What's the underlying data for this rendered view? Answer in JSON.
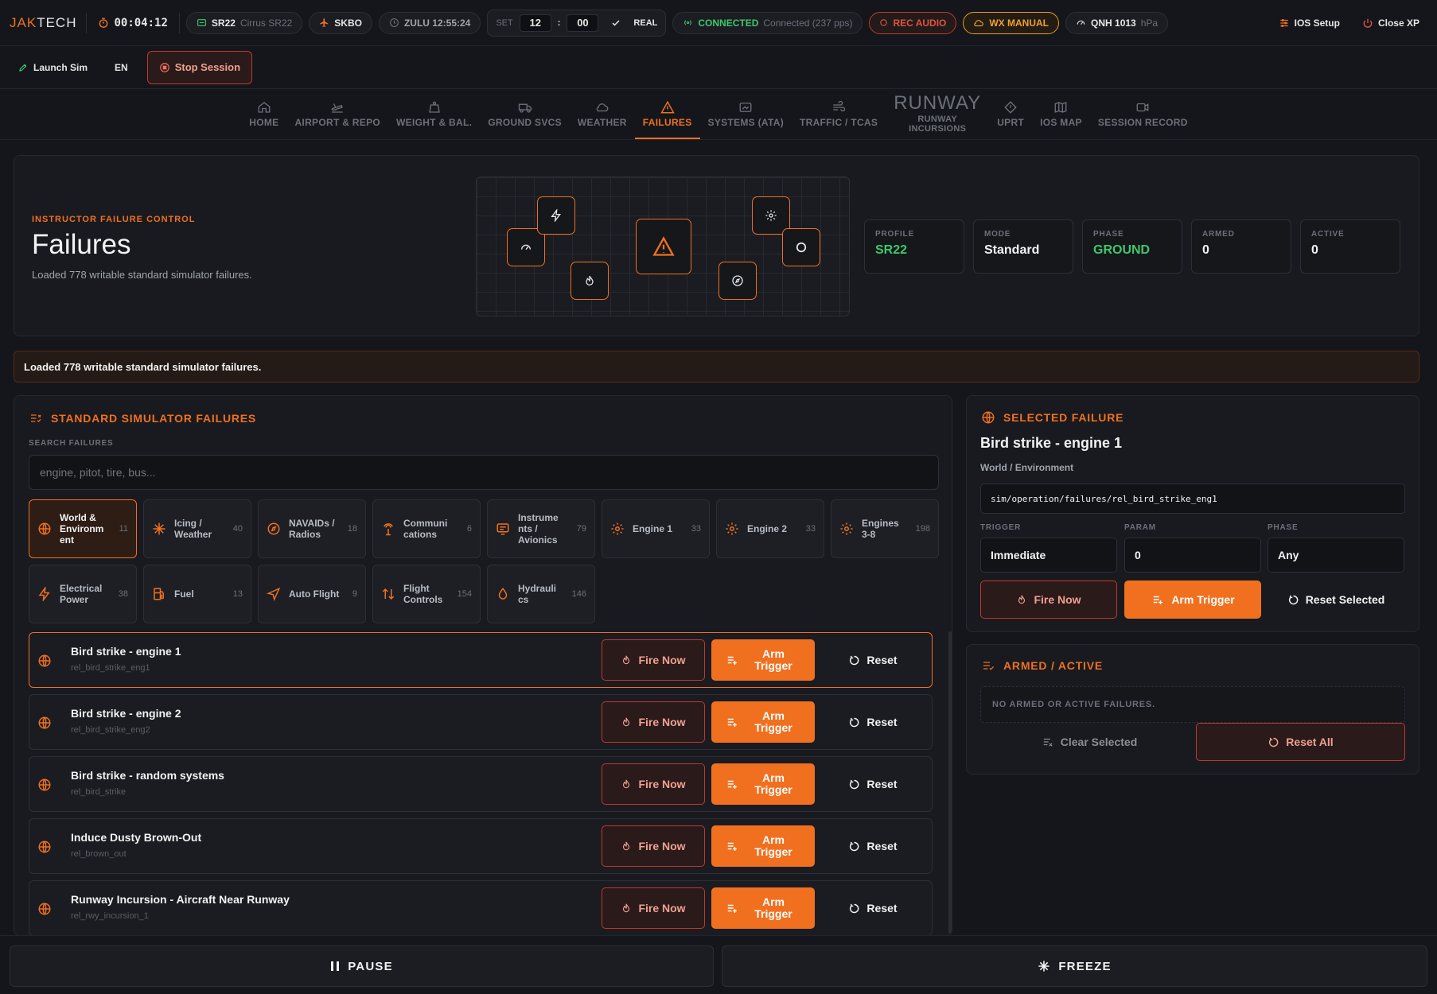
{
  "app": {
    "logo_a": "JAK",
    "logo_b": "TECH",
    "timer": "00:04:12"
  },
  "topbar": {
    "aircraft_code": "SR22",
    "aircraft_name": "Cirrus SR22",
    "airport": "SKBO",
    "zulu": "ZULU 12:55:24",
    "set_label": "SET",
    "set_hour": "12",
    "set_colon": ":",
    "set_min": "00",
    "set_real": "REAL",
    "conn_status": "CONNECTED",
    "conn_detail": "Connected (237 pps)",
    "rec_audio": "REC AUDIO",
    "wx_manual": "WX MANUAL",
    "qnh": "QNH 1013",
    "qnh_unit": "hPa",
    "ios_setup": "IOS Setup",
    "close_xp": "Close XP"
  },
  "row2": {
    "launch_sim": "Launch Sim",
    "lang": "EN",
    "stop_session": "Stop Session"
  },
  "nav": {
    "home": "HOME",
    "airport": "AIRPORT & REPO",
    "weight": "WEIGHT & BAL.",
    "ground": "GROUND SVCS",
    "weather": "WEATHER",
    "failures": "FAILURES",
    "systems": "SYSTEMS (ATA)",
    "traffic": "TRAFFIC / TCAS",
    "runway_big": "RUNWAY",
    "runway_1": "RUNWAY",
    "runway_2": "INCURSIONS",
    "uprt": "UPRT",
    "iosmap": "IOS MAP",
    "session": "SESSION RECORD"
  },
  "hero": {
    "eyebrow": "INSTRUCTOR FAILURE CONTROL",
    "title": "Failures",
    "desc": "Loaded 778 writable standard simulator failures.",
    "stats": [
      {
        "label": "PROFILE",
        "value": "SR22"
      },
      {
        "label": "MODE",
        "value": "Standard"
      },
      {
        "label": "PHASE",
        "value": "GROUND"
      },
      {
        "label": "ARMED",
        "value": "0"
      },
      {
        "label": "ACTIVE",
        "value": "0"
      }
    ]
  },
  "banner": "Loaded 778 writable standard simulator failures.",
  "standard": {
    "title": "STANDARD SIMULATOR FAILURES",
    "search_label": "SEARCH FAILURES",
    "search_placeholder": "engine, pitot, tire, bus...",
    "categories": [
      {
        "name": "World & Environm ent",
        "count": "11"
      },
      {
        "name": "Icing / Weather",
        "count": "40"
      },
      {
        "name": "NAVAIDs / Radios",
        "count": "18"
      },
      {
        "name": "Communi cations",
        "count": "6"
      },
      {
        "name": "Instrume nts / Avionics",
        "count": "79"
      },
      {
        "name": "Engine 1",
        "count": "33"
      },
      {
        "name": "Engine 2",
        "count": "33"
      },
      {
        "name": "Engines 3-8",
        "count": "198"
      },
      {
        "name": "Electrical Power",
        "count": "38"
      },
      {
        "name": "Fuel",
        "count": "13"
      },
      {
        "name": "Auto Flight",
        "count": "9"
      },
      {
        "name": "Flight Controls",
        "count": "154"
      },
      {
        "name": "Hydrauli cs",
        "count": "146"
      }
    ],
    "fire_label": "Fire Now",
    "arm_label_1": "Arm",
    "arm_label_2": "Trigger",
    "reset_label": "Reset",
    "failures": [
      {
        "name": "Bird strike - engine 1",
        "id": "rel_bird_strike_eng1"
      },
      {
        "name": "Bird strike - engine 2",
        "id": "rel_bird_strike_eng2"
      },
      {
        "name": "Bird strike - random systems",
        "id": "rel_bird_strike"
      },
      {
        "name": "Induce Dusty Brown-Out",
        "id": "rel_brown_out"
      },
      {
        "name": "Runway Incursion - Aircraft Near Runway",
        "id": "rel_rwy_incursion_1"
      }
    ]
  },
  "selected": {
    "title": "SELECTED FAILURE",
    "name": "Bird strike - engine 1",
    "category": "World / Environment",
    "dataref": "sim/operation/failures/rel_bird_strike_eng1",
    "trigger_label": "TRIGGER",
    "trigger_value": "Immediate",
    "param_label": "PARAM",
    "param_value": "0",
    "phase_label": "PHASE",
    "phase_value": "Any",
    "fire": "Fire Now",
    "arm": "Arm Trigger",
    "reset": "Reset Selected"
  },
  "armed": {
    "title": "ARMED / ACTIVE",
    "empty": "NO ARMED OR ACTIVE FAILURES.",
    "clear": "Clear Selected",
    "reset_all": "Reset All"
  },
  "bottom": {
    "pause": "PAUSE",
    "freeze": "FREEZE"
  },
  "colors": {
    "accent": "#f07020",
    "ok": "#3fc86a",
    "danger": "#c0392b",
    "warn": "#e89a20",
    "bg": "#14161b"
  }
}
